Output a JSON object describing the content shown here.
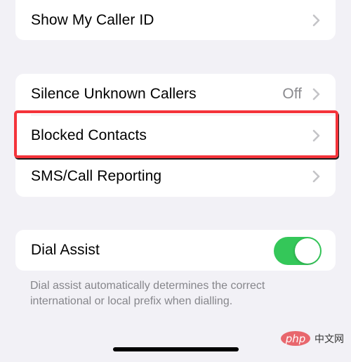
{
  "colors": {
    "background": "#f2f1f6",
    "card": "#ffffff",
    "highlight": "#f4333a",
    "toggle_on": "#34c759",
    "secondary_text": "#8a8a8e"
  },
  "group1": {
    "rows": [
      {
        "label": "Show My Caller ID",
        "icon": "chevron-right-icon"
      }
    ]
  },
  "group2": {
    "rows": [
      {
        "label": "Silence Unknown Callers",
        "value": "Off",
        "icon": "chevron-right-icon"
      },
      {
        "label": "Blocked Contacts",
        "icon": "chevron-right-icon",
        "highlighted": true
      },
      {
        "label": "SMS/Call Reporting",
        "icon": "chevron-right-icon"
      }
    ]
  },
  "group3": {
    "rows": [
      {
        "label": "Dial Assist",
        "toggle": "on"
      }
    ],
    "footer": "Dial assist automatically determines the correct international or local prefix when dialling."
  },
  "watermark": {
    "logo": "php",
    "text": "中文网"
  }
}
